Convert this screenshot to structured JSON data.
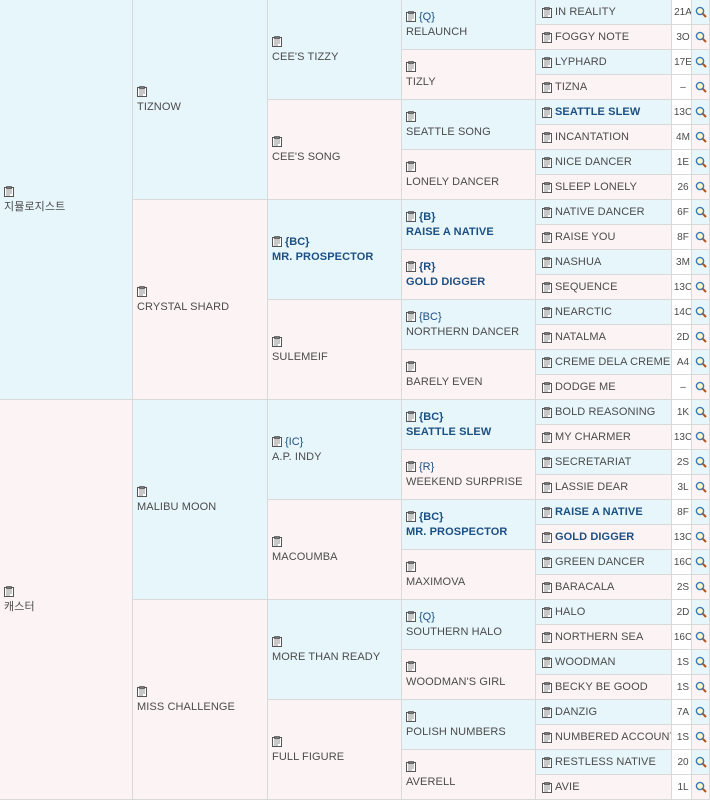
{
  "pedigree": {
    "g1": [
      {
        "name": "지뮬로지스트"
      },
      {
        "name": "캐스터"
      }
    ],
    "g2": [
      {
        "name": "TIZNOW"
      },
      {
        "name": "CRYSTAL SHARD"
      },
      {
        "name": "MALIBU MOON"
      },
      {
        "name": "MISS CHALLENGE"
      }
    ],
    "g3": [
      {
        "name": "CEE'S TIZZY",
        "tag": "",
        "bold": false
      },
      {
        "name": "CEE'S SONG",
        "tag": "",
        "bold": false
      },
      {
        "name": "MR. PROSPECTOR",
        "tag": "{BC}",
        "bold": true
      },
      {
        "name": "SULEMEIF",
        "tag": "",
        "bold": false
      },
      {
        "name": "A.P. INDY",
        "tag": "{IC}",
        "bold": false
      },
      {
        "name": "MACOUMBA",
        "tag": "",
        "bold": false
      },
      {
        "name": "MORE THAN READY",
        "tag": "",
        "bold": false
      },
      {
        "name": "FULL FIGURE",
        "tag": "",
        "bold": false
      }
    ],
    "g4": [
      {
        "name": "RELAUNCH",
        "tag": "{Q}",
        "bold": false
      },
      {
        "name": "TIZLY",
        "tag": "",
        "bold": false
      },
      {
        "name": "SEATTLE SONG",
        "tag": "",
        "bold": false
      },
      {
        "name": "LONELY DANCER",
        "tag": "",
        "bold": false
      },
      {
        "name": "RAISE A NATIVE",
        "tag": "{B}",
        "bold": true
      },
      {
        "name": "GOLD DIGGER",
        "tag": "{R}",
        "bold": true
      },
      {
        "name": "NORTHERN DANCER",
        "tag": "{BC}",
        "bold": false
      },
      {
        "name": "BARELY EVEN",
        "tag": "",
        "bold": false
      },
      {
        "name": "SEATTLE SLEW",
        "tag": "{BC}",
        "bold": true
      },
      {
        "name": "WEEKEND SURPRISE",
        "tag": "{R}",
        "bold": false
      },
      {
        "name": "MR. PROSPECTOR",
        "tag": "{BC}",
        "bold": true
      },
      {
        "name": "MAXIMOVA",
        "tag": "",
        "bold": false
      },
      {
        "name": "SOUTHERN HALO",
        "tag": "{Q}",
        "bold": false
      },
      {
        "name": "WOODMAN'S GIRL",
        "tag": "",
        "bold": false
      },
      {
        "name": "POLISH NUMBERS",
        "tag": "",
        "bold": false
      },
      {
        "name": "AVERELL",
        "tag": "",
        "bold": false
      }
    ],
    "g5": [
      {
        "name": "IN REALITY",
        "rec": "21A",
        "bold": false
      },
      {
        "name": "FOGGY NOTE",
        "rec": "3O",
        "bold": false
      },
      {
        "name": "LYPHARD",
        "rec": "17E",
        "bold": false
      },
      {
        "name": "TIZNA",
        "rec": "–",
        "bold": false
      },
      {
        "name": "SEATTLE SLEW",
        "rec": "13C",
        "bold": true
      },
      {
        "name": "INCANTATION",
        "rec": "4M",
        "bold": false
      },
      {
        "name": "NICE DANCER",
        "rec": "1E",
        "bold": false
      },
      {
        "name": "SLEEP LONELY",
        "rec": "26",
        "bold": false
      },
      {
        "name": "NATIVE DANCER",
        "rec": "6F",
        "bold": false
      },
      {
        "name": "RAISE YOU",
        "rec": "8F",
        "bold": false
      },
      {
        "name": "NASHUA",
        "rec": "3M",
        "bold": false
      },
      {
        "name": "SEQUENCE",
        "rec": "13C",
        "bold": false
      },
      {
        "name": "NEARCTIC",
        "rec": "14C",
        "bold": false
      },
      {
        "name": "NATALMA",
        "rec": "2D",
        "bold": false
      },
      {
        "name": "CREME DELA CREME",
        "rec": "A4",
        "bold": false
      },
      {
        "name": "DODGE ME",
        "rec": "–",
        "bold": false
      },
      {
        "name": "BOLD REASONING",
        "rec": "1K",
        "bold": false
      },
      {
        "name": "MY CHARMER",
        "rec": "13C",
        "bold": false
      },
      {
        "name": "SECRETARIAT",
        "rec": "2S",
        "bold": false
      },
      {
        "name": "LASSIE DEAR",
        "rec": "3L",
        "bold": false
      },
      {
        "name": "RAISE A NATIVE",
        "rec": "8F",
        "bold": true
      },
      {
        "name": "GOLD DIGGER",
        "rec": "13C",
        "bold": true
      },
      {
        "name": "GREEN DANCER",
        "rec": "16C",
        "bold": false
      },
      {
        "name": "BARACALA",
        "rec": "2S",
        "bold": false
      },
      {
        "name": "HALO",
        "rec": "2D",
        "bold": false
      },
      {
        "name": "NORTHERN SEA",
        "rec": "16C",
        "bold": false
      },
      {
        "name": "WOODMAN",
        "rec": "1S",
        "bold": false
      },
      {
        "name": "BECKY BE GOOD",
        "rec": "1S",
        "bold": false
      },
      {
        "name": "DANZIG",
        "rec": "7A",
        "bold": false
      },
      {
        "name": "NUMBERED ACCOUNT",
        "rec": "1S",
        "bold": false
      },
      {
        "name": "RESTLESS NATIVE",
        "rec": "20",
        "bold": false
      },
      {
        "name": "AVIE",
        "rec": "1L",
        "bold": false
      }
    ]
  },
  "icons": {
    "record": "clipboard-icon",
    "search": "magnifier-icon"
  },
  "colors": {
    "sire_bg": "#e7f6fb",
    "dam_bg": "#fcf4f4",
    "bold_name": "#1c4f83",
    "text": "#4b4b4b",
    "border": "#d9d9d9"
  }
}
